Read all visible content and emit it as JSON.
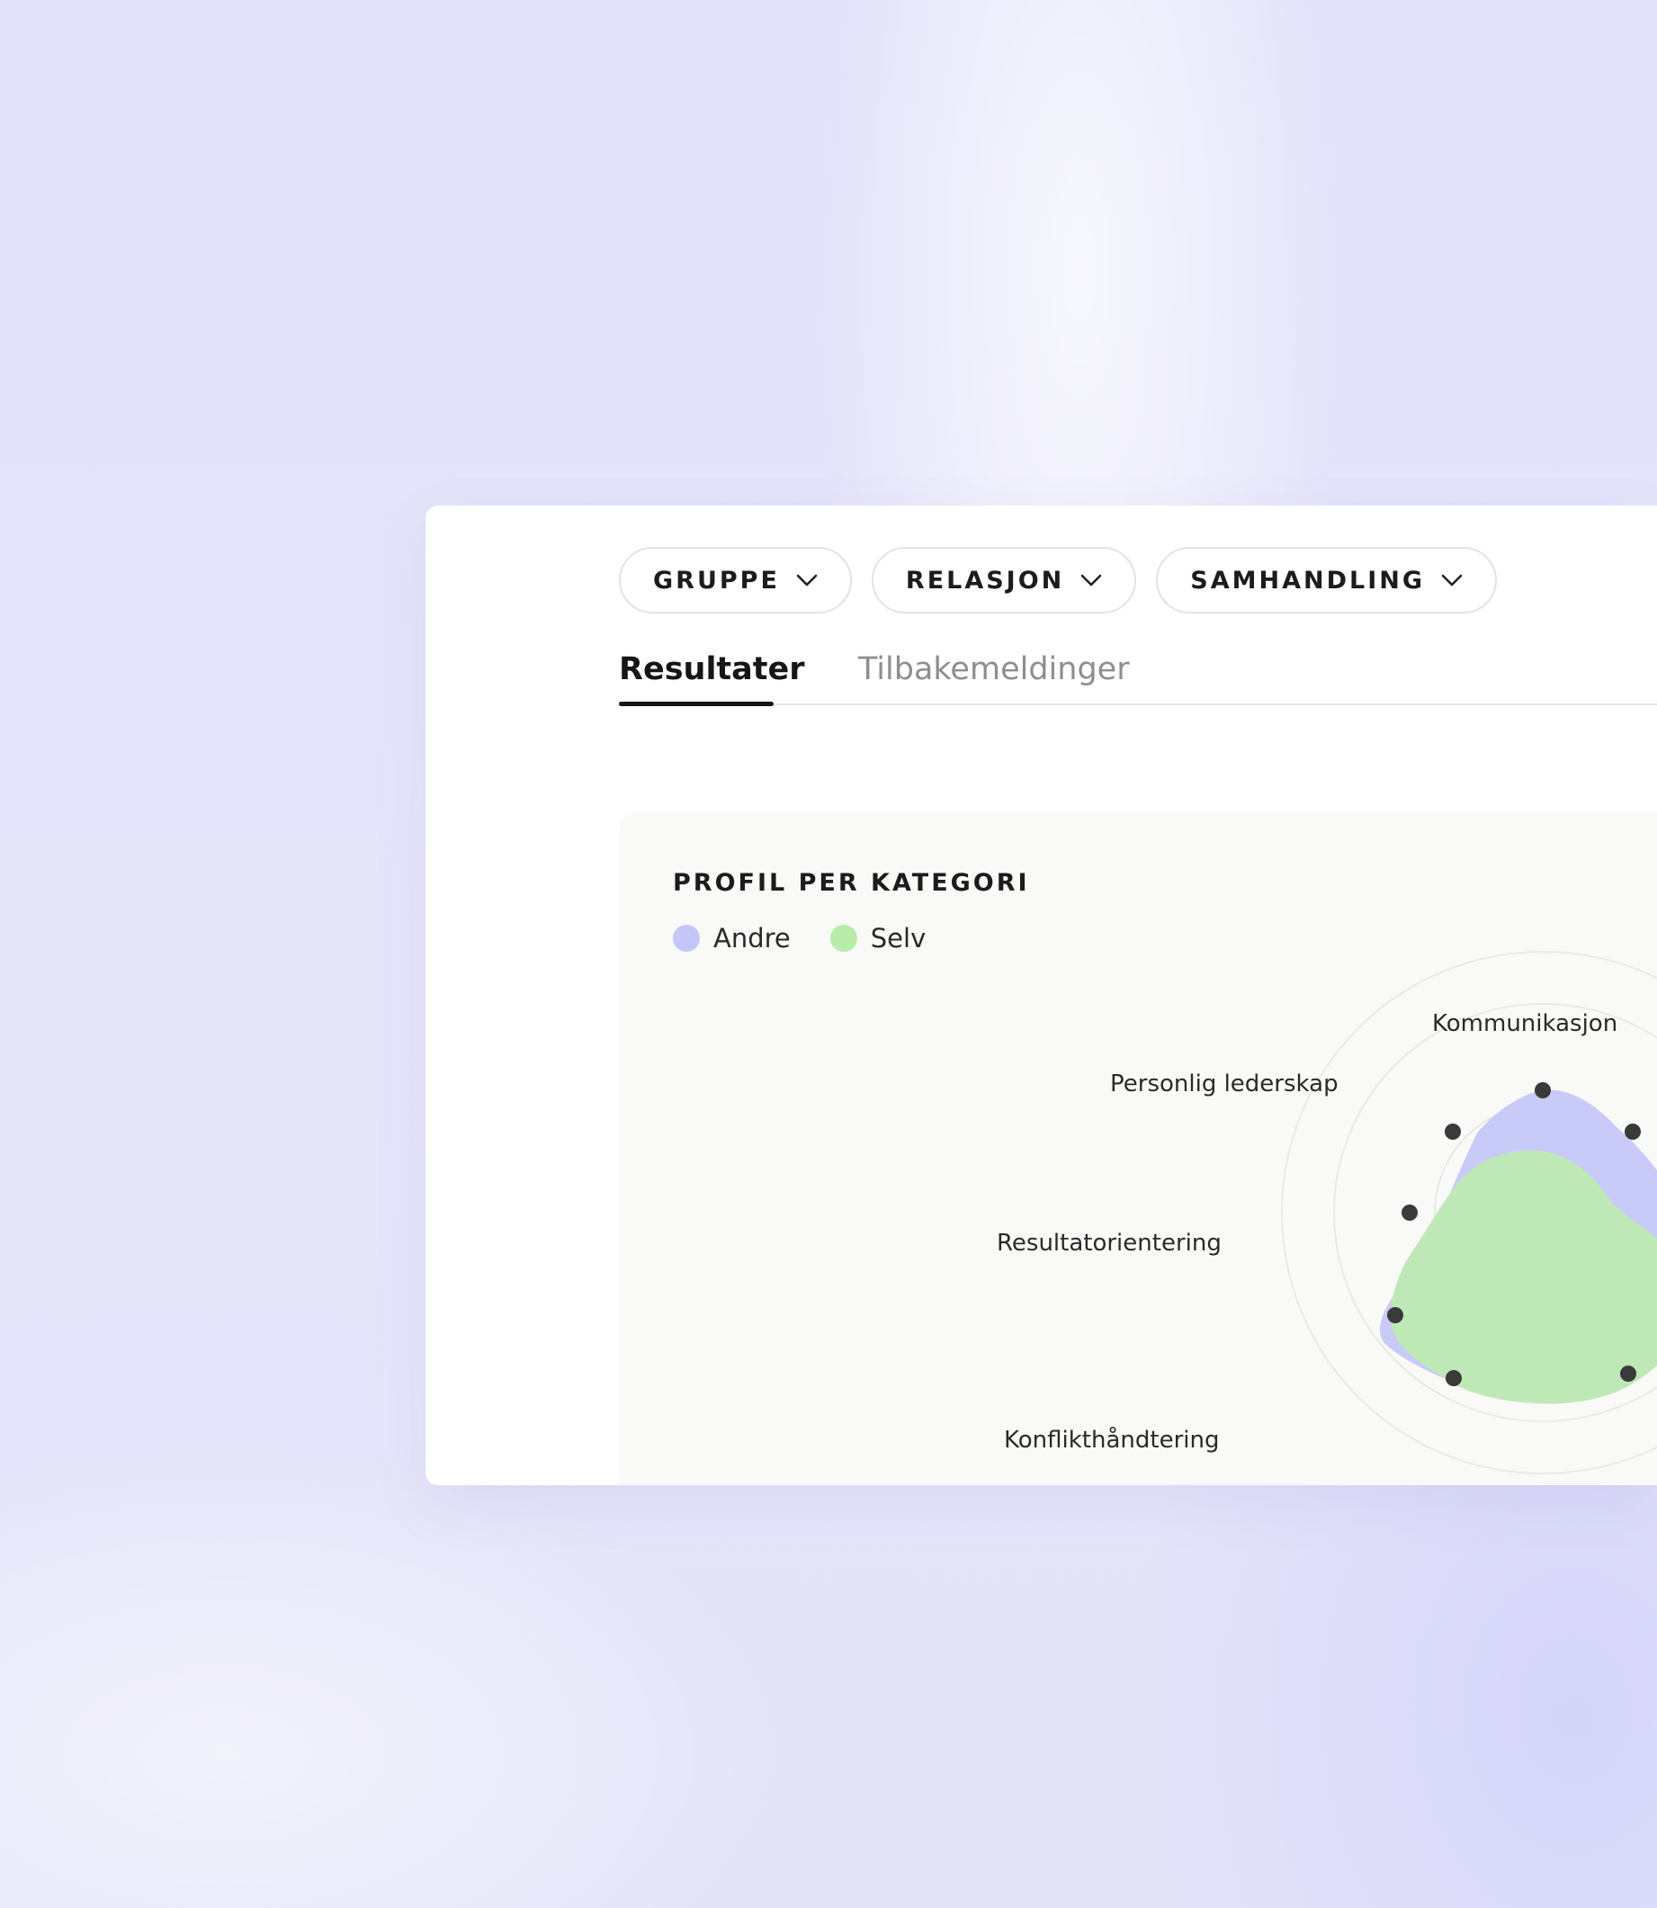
{
  "filters": [
    {
      "label": "GRUPPE"
    },
    {
      "label": "RELASJON"
    },
    {
      "label": "SAMHANDLING"
    }
  ],
  "tabs": {
    "active": "Resultater",
    "inactive": "Tilbakemeldinger"
  },
  "panel": {
    "title": "PROFIL PER KATEGORI"
  },
  "legend": [
    {
      "label": "Andre",
      "color": "#c3c6f7"
    },
    {
      "label": "Selv",
      "color": "#b8ecaa"
    }
  ],
  "categories": {
    "kommunikasjon": "Kommunikasjon",
    "personlig_lederskap": "Personlig lederskap",
    "resultatorientering": "Resultatorientering",
    "konflikthandtering": "Konflikthåndtering"
  },
  "colors": {
    "andre_fill": "#c8cbf7",
    "selv_fill": "#bfe8b7",
    "point": "#3a3a3a"
  }
}
